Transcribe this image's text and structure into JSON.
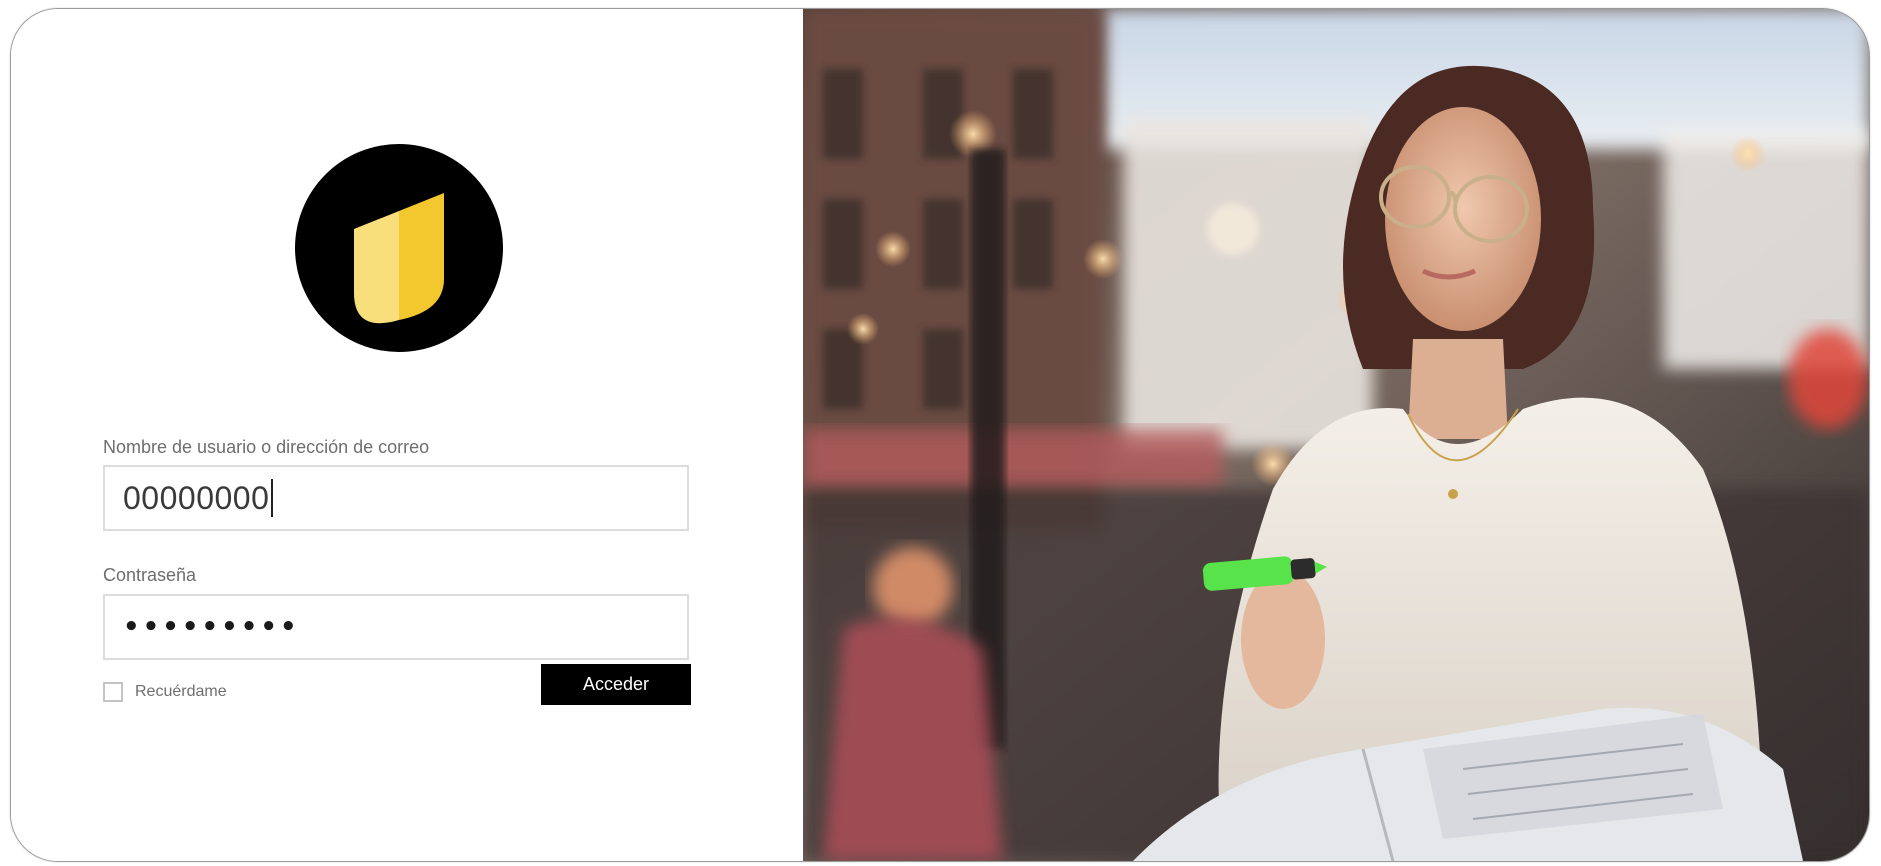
{
  "login": {
    "username_label": "Nombre de usuario o dirección de correo",
    "username_value": "00000000",
    "password_label": "Contraseña",
    "password_value": "•••••••••",
    "remember_label": "Recuérdame",
    "submit_label": "Acceder"
  },
  "brand": {
    "logo_icon": "leaf-shield-logo",
    "logo_bg": "#000000",
    "logo_light": "#f9de7c",
    "logo_dark": "#f2c82e"
  },
  "hero": {
    "image_icon": "woman-studying-cafe-photo"
  }
}
